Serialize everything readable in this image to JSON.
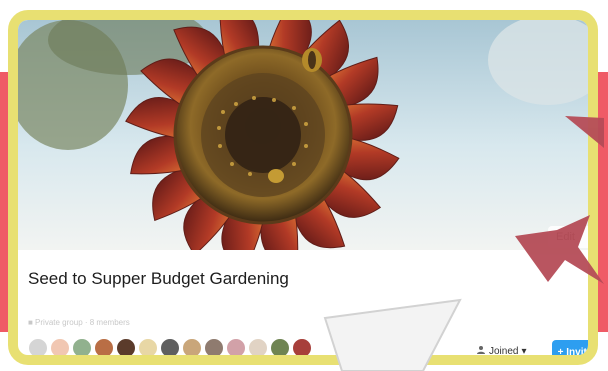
{
  "group": {
    "title": "Seed to Supper Budget Gardening",
    "meta": "■ Private group · 8 members"
  },
  "cover": {
    "edit_label": "Edit"
  },
  "actions": {
    "joined_label": "Joined",
    "invite_label": "+ Invite"
  },
  "icons": {
    "joined": "person-icon",
    "dropdown": "chevron-down-icon",
    "decor": "hummingbird-icon"
  },
  "colors": {
    "frame": "#e8e072",
    "background_band": "#ef5b66",
    "invite": "#2d9ef0",
    "sunflower_petals": "#9a2b22",
    "bird": "#b54c57"
  }
}
